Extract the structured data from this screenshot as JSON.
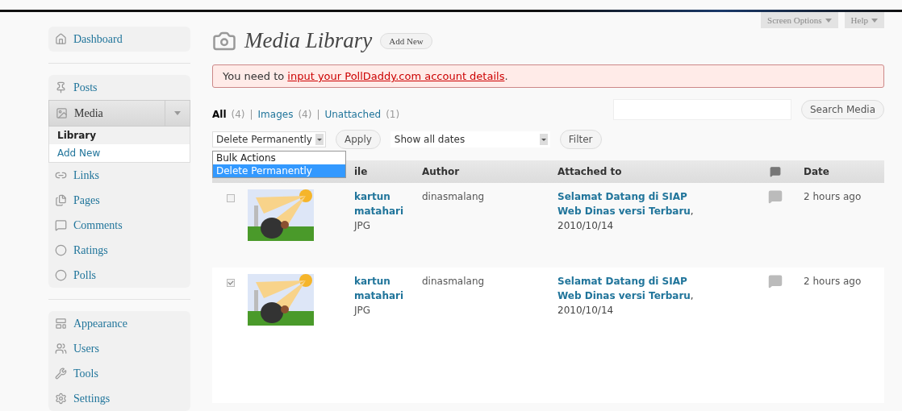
{
  "sidebar": {
    "groups": [
      {
        "items": [
          {
            "label": "Dashboard",
            "expanded": false
          }
        ]
      },
      {
        "items": [
          {
            "label": "Posts",
            "expanded": false
          },
          {
            "label": "Media",
            "expanded": true,
            "children": [
              {
                "label": "Library",
                "selected": true
              },
              {
                "label": "Add New",
                "selected": false
              }
            ]
          },
          {
            "label": "Links",
            "expanded": false
          },
          {
            "label": "Pages",
            "expanded": false
          },
          {
            "label": "Comments",
            "expanded": false
          },
          {
            "label": "Ratings",
            "expanded": false
          },
          {
            "label": "Polls",
            "expanded": false
          }
        ]
      },
      {
        "items": [
          {
            "label": "Appearance",
            "expanded": false
          },
          {
            "label": "Users",
            "expanded": false
          },
          {
            "label": "Tools",
            "expanded": false
          },
          {
            "label": "Settings",
            "expanded": false
          }
        ]
      }
    ]
  },
  "header": {
    "title": "Media Library",
    "add_new": "Add New",
    "screen_options": "Screen Options",
    "help": "Help"
  },
  "notice": {
    "prefix": "You need to ",
    "link": "input your PollDaddy.com account details",
    "suffix": "."
  },
  "filters": [
    {
      "label": "All",
      "count": "(4)",
      "selected": true
    },
    {
      "label": "Images",
      "count": "(4)",
      "selected": false
    },
    {
      "label": "Unattached",
      "count": "(1)",
      "selected": false
    }
  ],
  "filter_separators": [
    "|",
    "|"
  ],
  "search": {
    "button": "Search Media"
  },
  "bulk_actions": {
    "value": "Delete Permanently",
    "open": true,
    "options": [
      {
        "label": "Bulk Actions",
        "selected": false
      },
      {
        "label": "Delete Permanently",
        "selected": true
      }
    ]
  },
  "apply": "Apply",
  "dates": {
    "value": "Show all dates"
  },
  "filter_button": "Filter",
  "table": {
    "columns": [
      "ile",
      "Author",
      "Attached to",
      "Date"
    ],
    "rows": [
      {
        "checked": false,
        "title": "kartun matahari",
        "type": "JPG",
        "author": "dinasmalang",
        "attached_to": "**Selamat Datang di SIAP Web Dinas versi Terbaru**, 2010/10/14",
        "date": "2 hours ago"
      },
      {
        "checked": true,
        "title": "kartun matahari",
        "type": "JPG",
        "author": "dinasmalang",
        "attached_to": "**Selamat Datang di SIAP Web Dinas versi Terbaru**, 2010/10/14",
        "date": "2 hours ago"
      }
    ]
  }
}
